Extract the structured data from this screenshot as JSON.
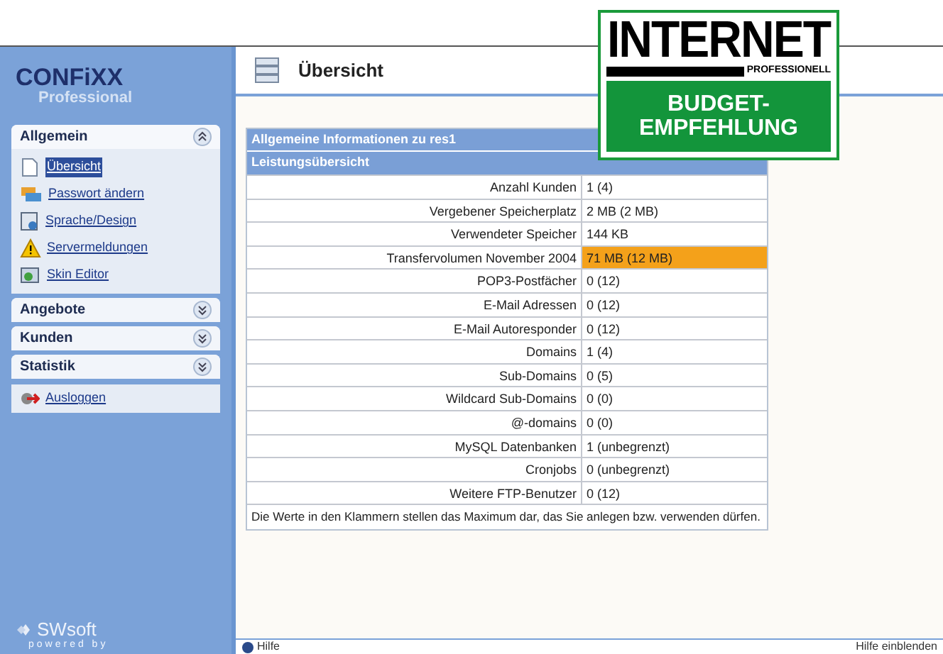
{
  "logo": {
    "title": "CONFiXX",
    "subtitle": "Professional"
  },
  "sidebar": {
    "sections": [
      {
        "title": "Allgemein",
        "expanded": true,
        "items": [
          {
            "label": "Übersicht",
            "kind": "page",
            "selected": true
          },
          {
            "label": "Passwort ändern",
            "kind": "key",
            "selected": false
          },
          {
            "label": "Sprache/Design",
            "kind": "design",
            "selected": false
          },
          {
            "label": "Servermeldungen",
            "kind": "warning",
            "selected": false
          },
          {
            "label": "Skin Editor",
            "kind": "skin",
            "selected": false
          }
        ]
      },
      {
        "title": "Angebote",
        "expanded": false
      },
      {
        "title": "Kunden",
        "expanded": false
      },
      {
        "title": "Statistik",
        "expanded": false
      }
    ],
    "logout": "Ausloggen",
    "vendor": {
      "name": "SWsoft",
      "tagline": "powered by"
    }
  },
  "header": {
    "title": "Übersicht"
  },
  "badge": {
    "line_1": "INTERNET",
    "line_2": "PROFESSIONELL",
    "line_3": "BUDGET-",
    "line_4": "EMPFEHLUNG"
  },
  "table": {
    "title": "Allgemeine Informationen zu res1",
    "subtitle": "Leistungsübersicht",
    "rows": [
      {
        "label": "Anzahl Kunden",
        "value": "1 (4)",
        "warning": false
      },
      {
        "label": "Vergebener Speicherplatz",
        "value": "2 MB (2 MB)",
        "warning": false
      },
      {
        "label": "Verwendeter Speicher",
        "value": "144 KB",
        "warning": false
      },
      {
        "label": "Transfervolumen November 2004",
        "value": "71 MB (12 MB)",
        "warning": true
      },
      {
        "label": "POP3-Postfächer",
        "value": "0 (12)",
        "warning": false
      },
      {
        "label": "E-Mail Adressen",
        "value": "0 (12)",
        "warning": false
      },
      {
        "label": "E-Mail Autoresponder",
        "value": "0 (12)",
        "warning": false
      },
      {
        "label": "Domains",
        "value": "1 (4)",
        "warning": false
      },
      {
        "label": "Sub-Domains",
        "value": "0 (5)",
        "warning": false
      },
      {
        "label": "Wildcard Sub-Domains",
        "value": "0 (0)",
        "warning": false
      },
      {
        "label": "@-domains",
        "value": "0 (0)",
        "warning": false
      },
      {
        "label": "MySQL Datenbanken",
        "value": "1 (unbegrenzt)",
        "warning": false
      },
      {
        "label": "Cronjobs",
        "value": "0 (unbegrenzt)",
        "warning": false
      },
      {
        "label": "Weitere FTP-Benutzer",
        "value": "0 (12)",
        "warning": false
      }
    ],
    "note": "Die Werte in den Klammern stellen das Maximum dar, das Sie anlegen bzw. verwenden dürfen."
  },
  "status_bar": {
    "help": "Hilfe",
    "toggle": "Hilfe einblenden"
  }
}
